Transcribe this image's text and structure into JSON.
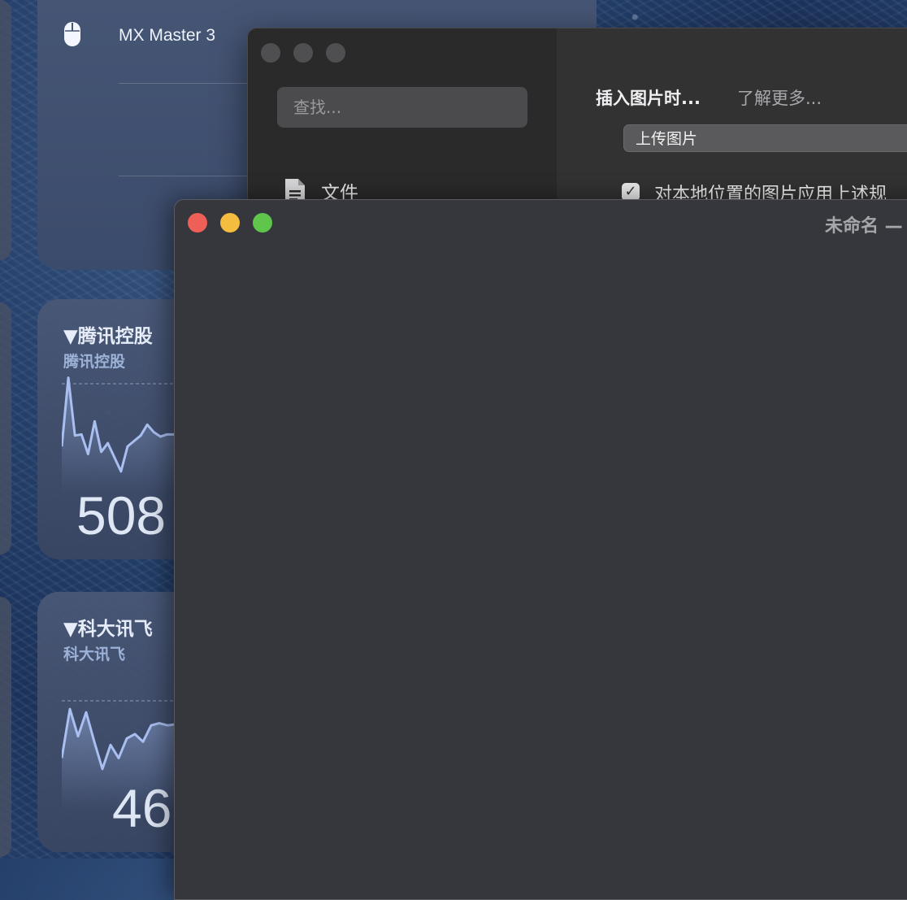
{
  "colors": {
    "wallpaper": "#24406b",
    "close": "#ee5f57",
    "minimize": "#f5bd3f",
    "zoom": "#5fc54b",
    "stock_line": "#a9bff0"
  },
  "mouse_widget": {
    "icon": "mouse-icon",
    "device_name": "MX Master 3"
  },
  "stocks": [
    {
      "title": "▼腾讯控股",
      "subtitle": "腾讯控股",
      "price": "508",
      "chart_data": {
        "type": "line",
        "values": [
          0.35,
          0.98,
          0.45,
          0.46,
          0.28,
          0.58,
          0.3,
          0.38,
          0.25,
          0.12,
          0.35,
          0.4,
          0.45,
          0.55,
          0.48,
          0.44,
          0.46,
          0.46,
          0.47,
          0.48,
          0.49,
          0.5
        ]
      }
    },
    {
      "title": "▼科大讯飞",
      "subtitle": "科大讯飞",
      "price": "46",
      "chart_data": {
        "type": "line",
        "values": [
          0.4,
          0.85,
          0.6,
          0.82,
          0.55,
          0.3,
          0.52,
          0.4,
          0.58,
          0.62,
          0.55,
          0.7,
          0.72,
          0.7,
          0.71,
          0.72,
          0.72,
          0.72
        ]
      }
    }
  ],
  "prefs_window": {
    "search_placeholder": "查找...",
    "sidebar_items": [
      {
        "icon": "document-icon",
        "label": "文件"
      }
    ],
    "insert_image_label": "插入图片时...",
    "learn_more": "了解更多...",
    "upload_option": "上传图片",
    "local_checkbox_label": "对本地位置的图片应用上述规"
  },
  "front_window": {
    "title": "未命名 —"
  }
}
